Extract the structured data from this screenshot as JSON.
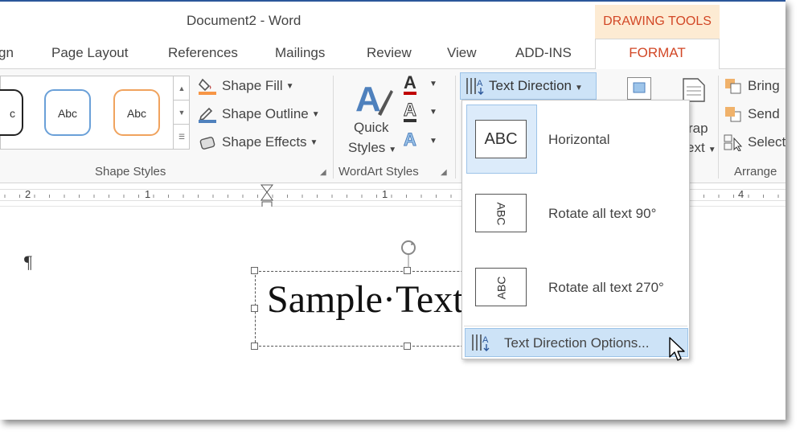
{
  "window": {
    "title": "Document2 - Word"
  },
  "contextual_tab_group": "DRAWING TOOLS",
  "tabs": [
    "gn",
    "Page Layout",
    "References",
    "Mailings",
    "Review",
    "View",
    "ADD-INS",
    "FORMAT"
  ],
  "active_tab": "FORMAT",
  "ribbon": {
    "shape_styles": {
      "label": "Shape Styles",
      "gallery": [
        "c",
        "Abc",
        "Abc"
      ],
      "shape_fill": "Shape Fill",
      "shape_outline": "Shape Outline",
      "shape_effects": "Shape Effects"
    },
    "wordart_styles": {
      "label": "WordArt Styles",
      "quick_styles_line1": "Quick",
      "quick_styles_line2": "Styles"
    },
    "text_direction": "Text Direction",
    "wrap_text_line1": "rap",
    "wrap_text_line2": "ext",
    "arrange": {
      "label": "Arrange",
      "bring": "Bring",
      "send": "Send",
      "select": "Select"
    }
  },
  "ruler": {
    "numbers": [
      "2",
      "1",
      "1",
      "4"
    ]
  },
  "document": {
    "pilcrow": "¶",
    "textbox_text": "Sample·Text"
  },
  "text_direction_menu": {
    "items": [
      {
        "preview": "ABC",
        "label": "Horizontal",
        "selected": true
      },
      {
        "preview": "ABC",
        "label": "Rotate all text 90°",
        "selected": false
      },
      {
        "preview": "ABC",
        "label": "Rotate all text 270°",
        "selected": false
      }
    ],
    "options": "Text Direction Options..."
  },
  "colors": {
    "accent_word": "#2b579a",
    "contextual_orange": "#d24726",
    "highlight": "#cde3f7"
  }
}
